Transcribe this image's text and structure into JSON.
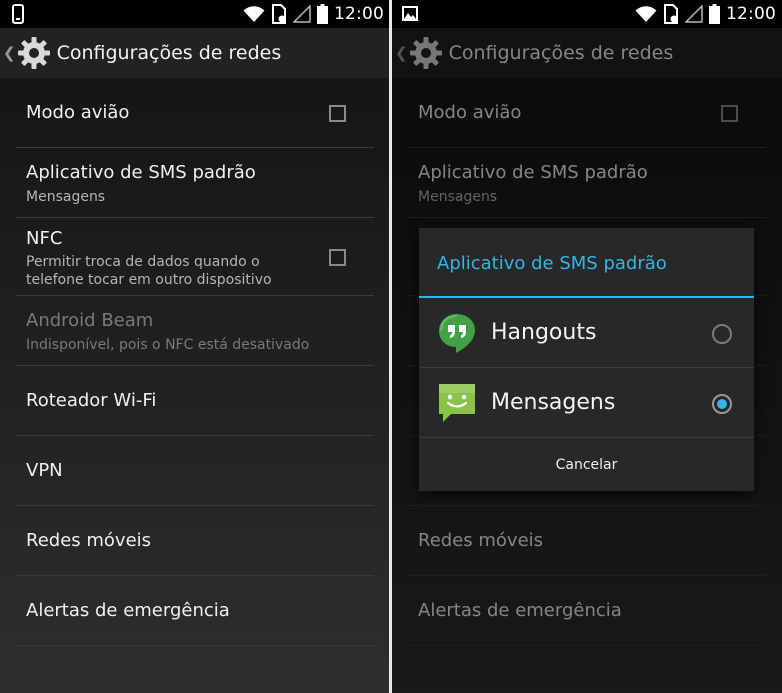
{
  "status_bar": {
    "time": "12:00"
  },
  "action_bar": {
    "title": "Configurações de redes"
  },
  "settings": {
    "airplane": {
      "title": "Modo avião"
    },
    "sms_default": {
      "title": "Aplicativo de SMS padrão",
      "summary": "Mensagens"
    },
    "nfc": {
      "title": "NFC",
      "summary_line1": "Permitir troca de dados quando o",
      "summary_line2": "telefone tocar em outro dispositivo"
    },
    "android_beam": {
      "title": "Android Beam",
      "summary": "Indisponível, pois o NFC está desativado"
    },
    "wifi_hotspot": {
      "title": "Roteador Wi-Fi"
    },
    "vpn": {
      "title": "VPN"
    },
    "mobile_networks": {
      "title": "Redes móveis"
    },
    "emergency_alerts": {
      "title": "Alertas de emergência"
    }
  },
  "dialog": {
    "title": "Aplicativo de SMS padrão",
    "options": [
      {
        "label": "Hangouts",
        "selected": false,
        "icon": "hangouts-icon"
      },
      {
        "label": "Mensagens",
        "selected": true,
        "icon": "messaging-icon"
      }
    ],
    "cancel_label": "Cancelar"
  },
  "colors": {
    "accent": "#33b5e5",
    "hangouts": "#43a047",
    "messaging": "#8bc34a"
  }
}
